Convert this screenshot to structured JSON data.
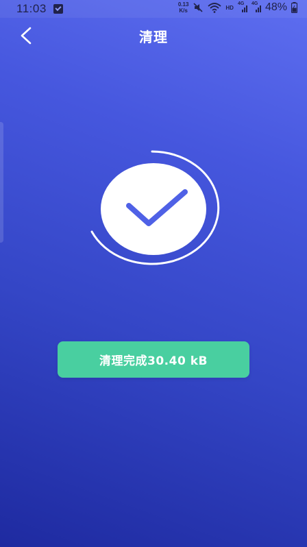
{
  "status_bar": {
    "time": "11:03",
    "net_speed_value": "0.13",
    "net_speed_unit": "K/s",
    "hd_label": "HD",
    "signal_1_tag": "4G",
    "signal_2_tag": "4G",
    "battery": "48%"
  },
  "header": {
    "title": "清理"
  },
  "result": {
    "button_label": "清理完成30.40 kB"
  },
  "colors": {
    "bg_top": "#5e6ef0",
    "bg_bottom": "#1e2aa0",
    "check": "#4f61e6",
    "accent_green": "#49cfa0"
  }
}
